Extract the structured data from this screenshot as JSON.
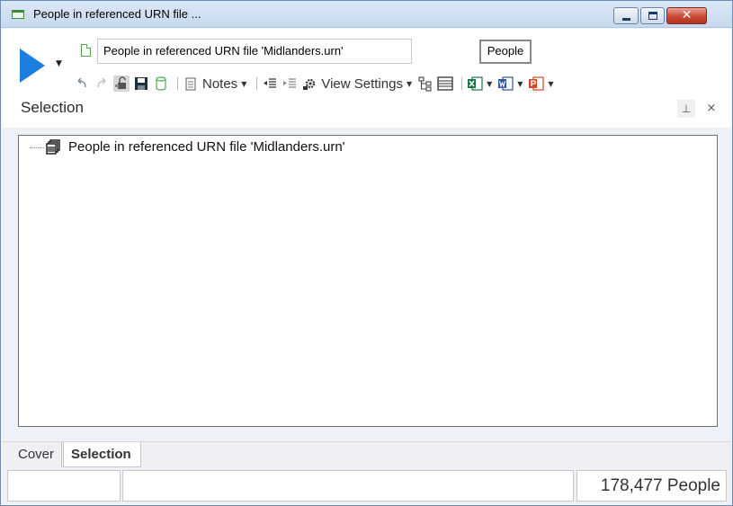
{
  "window": {
    "title": "People in referenced URN file ...",
    "controls": {
      "minimize": "minimize",
      "maximize": "maximize",
      "close": "✕"
    }
  },
  "toolbar": {
    "name_value": "People in referenced URN file 'Midlanders.urn'",
    "people_button": "People",
    "notes_label": "Notes",
    "view_settings_label": "View Settings",
    "icons": [
      "run-icon",
      "undo-icon",
      "redo-icon",
      "lock-icon",
      "save-icon",
      "database-icon",
      "clipboard-icon",
      "notes-icon",
      "indent-left-icon",
      "indent-right-icon",
      "settings-icon",
      "tree-view-icon",
      "grid-view-icon",
      "excel-icon",
      "word-icon",
      "powerpoint-icon"
    ]
  },
  "panel": {
    "title": "Selection",
    "pin_icon": "pin-icon",
    "close_icon": "close-icon"
  },
  "tree": {
    "items": [
      {
        "label": "People in referenced URN file 'Midlanders.urn'",
        "icon": "urn-file-icon"
      }
    ]
  },
  "tabs": [
    {
      "label": "Cover",
      "active": false
    },
    {
      "label": "Selection",
      "active": true
    }
  ],
  "status": {
    "cell1": "",
    "cell2": "",
    "count": "178,477 People"
  },
  "colors": {
    "accent_blue": "#1b7fe0",
    "excel_green": "#1e7145",
    "word_blue": "#2b579a",
    "powerpoint_red": "#d24726"
  }
}
